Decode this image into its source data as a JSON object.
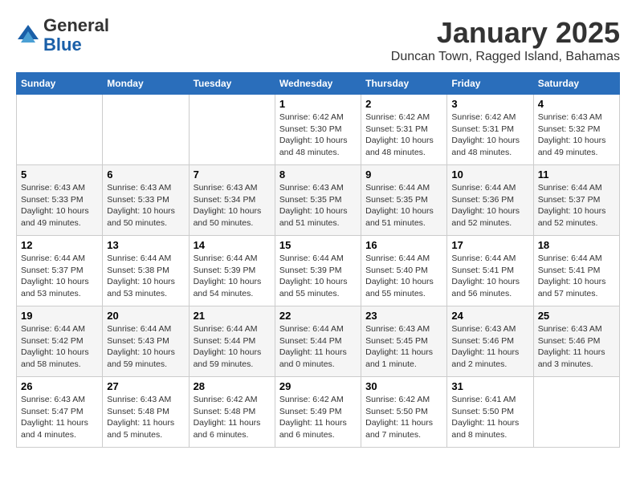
{
  "logo": {
    "general": "General",
    "blue": "Blue"
  },
  "header": {
    "month": "January 2025",
    "location": "Duncan Town, Ragged Island, Bahamas"
  },
  "days_of_week": [
    "Sunday",
    "Monday",
    "Tuesday",
    "Wednesday",
    "Thursday",
    "Friday",
    "Saturday"
  ],
  "weeks": [
    [
      {
        "day": "",
        "info": ""
      },
      {
        "day": "",
        "info": ""
      },
      {
        "day": "",
        "info": ""
      },
      {
        "day": "1",
        "info": "Sunrise: 6:42 AM\nSunset: 5:30 PM\nDaylight: 10 hours\nand 48 minutes."
      },
      {
        "day": "2",
        "info": "Sunrise: 6:42 AM\nSunset: 5:31 PM\nDaylight: 10 hours\nand 48 minutes."
      },
      {
        "day": "3",
        "info": "Sunrise: 6:42 AM\nSunset: 5:31 PM\nDaylight: 10 hours\nand 48 minutes."
      },
      {
        "day": "4",
        "info": "Sunrise: 6:43 AM\nSunset: 5:32 PM\nDaylight: 10 hours\nand 49 minutes."
      }
    ],
    [
      {
        "day": "5",
        "info": "Sunrise: 6:43 AM\nSunset: 5:33 PM\nDaylight: 10 hours\nand 49 minutes."
      },
      {
        "day": "6",
        "info": "Sunrise: 6:43 AM\nSunset: 5:33 PM\nDaylight: 10 hours\nand 50 minutes."
      },
      {
        "day": "7",
        "info": "Sunrise: 6:43 AM\nSunset: 5:34 PM\nDaylight: 10 hours\nand 50 minutes."
      },
      {
        "day": "8",
        "info": "Sunrise: 6:43 AM\nSunset: 5:35 PM\nDaylight: 10 hours\nand 51 minutes."
      },
      {
        "day": "9",
        "info": "Sunrise: 6:44 AM\nSunset: 5:35 PM\nDaylight: 10 hours\nand 51 minutes."
      },
      {
        "day": "10",
        "info": "Sunrise: 6:44 AM\nSunset: 5:36 PM\nDaylight: 10 hours\nand 52 minutes."
      },
      {
        "day": "11",
        "info": "Sunrise: 6:44 AM\nSunset: 5:37 PM\nDaylight: 10 hours\nand 52 minutes."
      }
    ],
    [
      {
        "day": "12",
        "info": "Sunrise: 6:44 AM\nSunset: 5:37 PM\nDaylight: 10 hours\nand 53 minutes."
      },
      {
        "day": "13",
        "info": "Sunrise: 6:44 AM\nSunset: 5:38 PM\nDaylight: 10 hours\nand 53 minutes."
      },
      {
        "day": "14",
        "info": "Sunrise: 6:44 AM\nSunset: 5:39 PM\nDaylight: 10 hours\nand 54 minutes."
      },
      {
        "day": "15",
        "info": "Sunrise: 6:44 AM\nSunset: 5:39 PM\nDaylight: 10 hours\nand 55 minutes."
      },
      {
        "day": "16",
        "info": "Sunrise: 6:44 AM\nSunset: 5:40 PM\nDaylight: 10 hours\nand 55 minutes."
      },
      {
        "day": "17",
        "info": "Sunrise: 6:44 AM\nSunset: 5:41 PM\nDaylight: 10 hours\nand 56 minutes."
      },
      {
        "day": "18",
        "info": "Sunrise: 6:44 AM\nSunset: 5:41 PM\nDaylight: 10 hours\nand 57 minutes."
      }
    ],
    [
      {
        "day": "19",
        "info": "Sunrise: 6:44 AM\nSunset: 5:42 PM\nDaylight: 10 hours\nand 58 minutes."
      },
      {
        "day": "20",
        "info": "Sunrise: 6:44 AM\nSunset: 5:43 PM\nDaylight: 10 hours\nand 59 minutes."
      },
      {
        "day": "21",
        "info": "Sunrise: 6:44 AM\nSunset: 5:44 PM\nDaylight: 10 hours\nand 59 minutes."
      },
      {
        "day": "22",
        "info": "Sunrise: 6:44 AM\nSunset: 5:44 PM\nDaylight: 11 hours\nand 0 minutes."
      },
      {
        "day": "23",
        "info": "Sunrise: 6:43 AM\nSunset: 5:45 PM\nDaylight: 11 hours\nand 1 minute."
      },
      {
        "day": "24",
        "info": "Sunrise: 6:43 AM\nSunset: 5:46 PM\nDaylight: 11 hours\nand 2 minutes."
      },
      {
        "day": "25",
        "info": "Sunrise: 6:43 AM\nSunset: 5:46 PM\nDaylight: 11 hours\nand 3 minutes."
      }
    ],
    [
      {
        "day": "26",
        "info": "Sunrise: 6:43 AM\nSunset: 5:47 PM\nDaylight: 11 hours\nand 4 minutes."
      },
      {
        "day": "27",
        "info": "Sunrise: 6:43 AM\nSunset: 5:48 PM\nDaylight: 11 hours\nand 5 minutes."
      },
      {
        "day": "28",
        "info": "Sunrise: 6:42 AM\nSunset: 5:48 PM\nDaylight: 11 hours\nand 6 minutes."
      },
      {
        "day": "29",
        "info": "Sunrise: 6:42 AM\nSunset: 5:49 PM\nDaylight: 11 hours\nand 6 minutes."
      },
      {
        "day": "30",
        "info": "Sunrise: 6:42 AM\nSunset: 5:50 PM\nDaylight: 11 hours\nand 7 minutes."
      },
      {
        "day": "31",
        "info": "Sunrise: 6:41 AM\nSunset: 5:50 PM\nDaylight: 11 hours\nand 8 minutes."
      },
      {
        "day": "",
        "info": ""
      }
    ]
  ]
}
